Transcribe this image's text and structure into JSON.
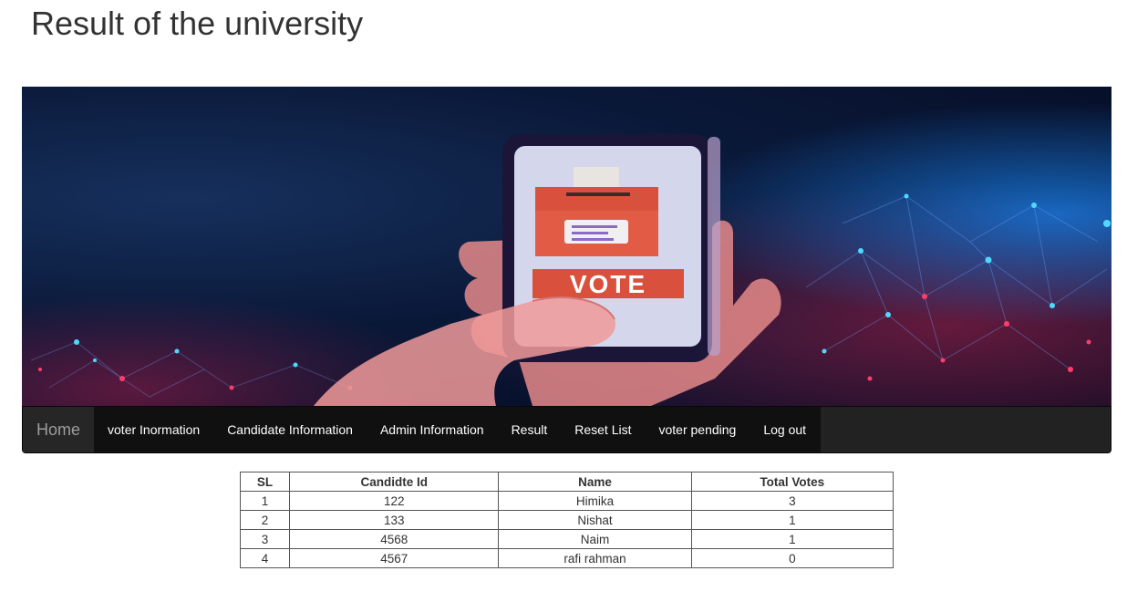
{
  "page": {
    "title": "Result of the university"
  },
  "banner": {
    "vote_label": "VOTE"
  },
  "navbar": {
    "items": [
      {
        "label": "Home"
      },
      {
        "label": "voter Inormation"
      },
      {
        "label": "Candidate Information"
      },
      {
        "label": "Admin Information"
      },
      {
        "label": "Result"
      },
      {
        "label": "Reset List"
      },
      {
        "label": "voter pending"
      },
      {
        "label": "Log out"
      }
    ]
  },
  "results_table": {
    "headers": [
      "SL",
      "Candidte Id",
      "Name",
      "Total Votes"
    ],
    "rows": [
      [
        "1",
        "122",
        "Himika",
        "3"
      ],
      [
        "2",
        "133",
        "Nishat",
        "1"
      ],
      [
        "3",
        "4568",
        "Naim",
        "1"
      ],
      [
        "4",
        "4567",
        "rafi rahman",
        "0"
      ]
    ]
  }
}
